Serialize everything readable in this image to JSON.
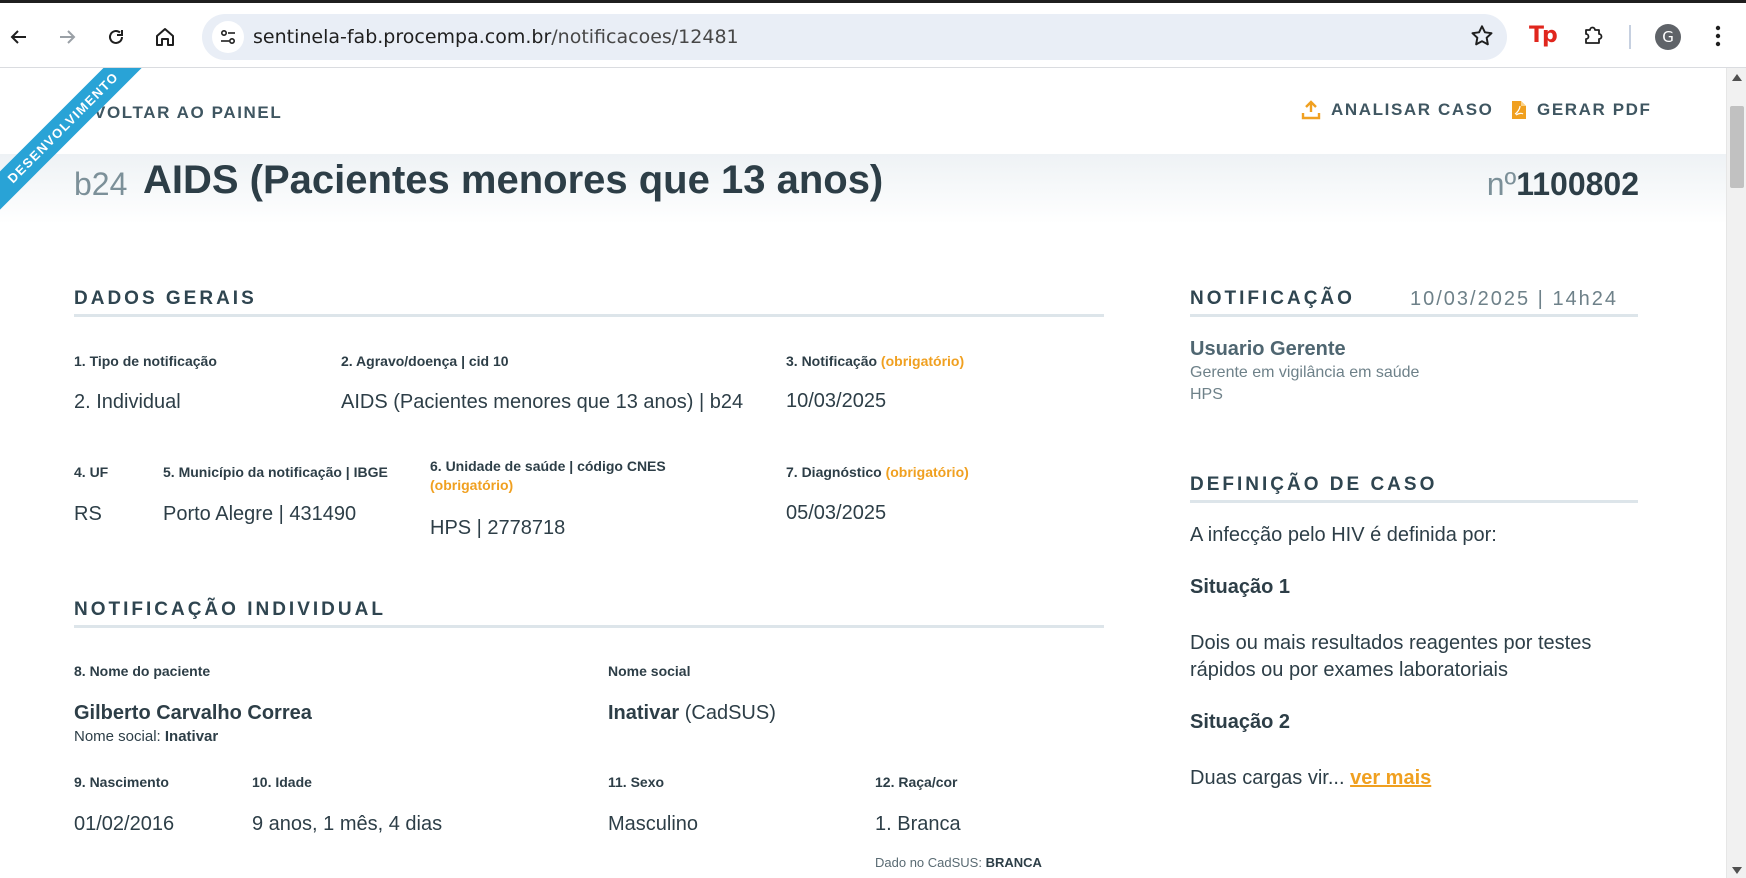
{
  "browser": {
    "url_domain": "sentinela-fab.procempa.com.br",
    "url_path": "/notificacoes/12481",
    "avatar_letter": "G",
    "extension_label": "Tp",
    "icons": [
      "back-arrow-icon",
      "forward-arrow-icon",
      "reload-icon",
      "home-icon",
      "site-settings-icon",
      "bookmark-star-icon",
      "extensions-puzzle-icon",
      "kebab-menu-icon"
    ]
  },
  "header": {
    "ribbon": "DESENVOLVIMENTO",
    "back_label": "VOLTAR AO PAINEL",
    "analyze_label": "ANALISAR CASO",
    "pdf_label": "GERAR PDF",
    "accent_color": "#f0a020"
  },
  "case": {
    "code": "b24",
    "title": "AIDS (Pacientes menores que 13 anos)",
    "number_prefix": "nº",
    "number": "1100802"
  },
  "dados_gerais": {
    "heading": "DADOS GERAIS",
    "tipo_label": "1. Tipo de notificação",
    "tipo_value": "2. Individual",
    "agravo_label": "2. Agravo/doença | cid 10",
    "agravo_value": "AIDS (Pacientes menores que 13 anos) | b24",
    "notificacao_label": "3. Notificação",
    "notificacao_req": "(obrigatório)",
    "notificacao_value": "10/03/2025",
    "uf_label": "4. UF",
    "uf_value": "RS",
    "municipio_label": "5. Município da notificação | IBGE",
    "municipio_value": "Porto Alegre | 431490",
    "unidade_label": "6. Unidade de saúde | código CNES",
    "unidade_req": "(obrigatório)",
    "unidade_value": "HPS | 2778718",
    "diagnostico_label": "7. Diagnóstico",
    "diagnostico_req": "(obrigatório)",
    "diagnostico_value": "05/03/2025"
  },
  "notificacao_individual": {
    "heading": "NOTIFICAÇÃO INDIVIDUAL",
    "nome_label": "8. Nome do paciente",
    "nome_value": "Gilberto Carvalho Correa",
    "nome_social_inline_label": "Nome social:",
    "nome_social_inline_value": "Inativar",
    "nome_social_label": "Nome social",
    "nome_social_value": "Inativar",
    "nome_social_source": "(CadSUS)",
    "nascimento_label": "9. Nascimento",
    "nascimento_value": "01/02/2016",
    "idade_label": "10. Idade",
    "idade_value": "9 anos, 1 mês, 4 dias",
    "sexo_label": "11. Sexo",
    "sexo_value": "Masculino",
    "raca_label": "12. Raça/cor",
    "raca_value": "1. Branca",
    "raca_cadsus_label": "Dado no CadSUS:",
    "raca_cadsus_value": "BRANCA"
  },
  "notificacao_panel": {
    "heading": "NOTIFICAÇÃO",
    "date": "10/03/2025",
    "separator": "|",
    "time": "14h24",
    "user_name": "Usuario Gerente",
    "user_role": "Gerente em vigilância em saúde",
    "user_unit": "HPS"
  },
  "definicao": {
    "heading": "DEFINIÇÃO DE CASO",
    "intro": "A infecção pelo HIV é definida por:",
    "situacao1_title": "Situação 1",
    "situacao1_text": "Dois ou mais resultados reagentes por testes rápidos ou por exames laboratoriais",
    "situacao2_title": "Situação 2",
    "situacao2_text": "Duas cargas vir...",
    "more_link": "ver mais"
  }
}
